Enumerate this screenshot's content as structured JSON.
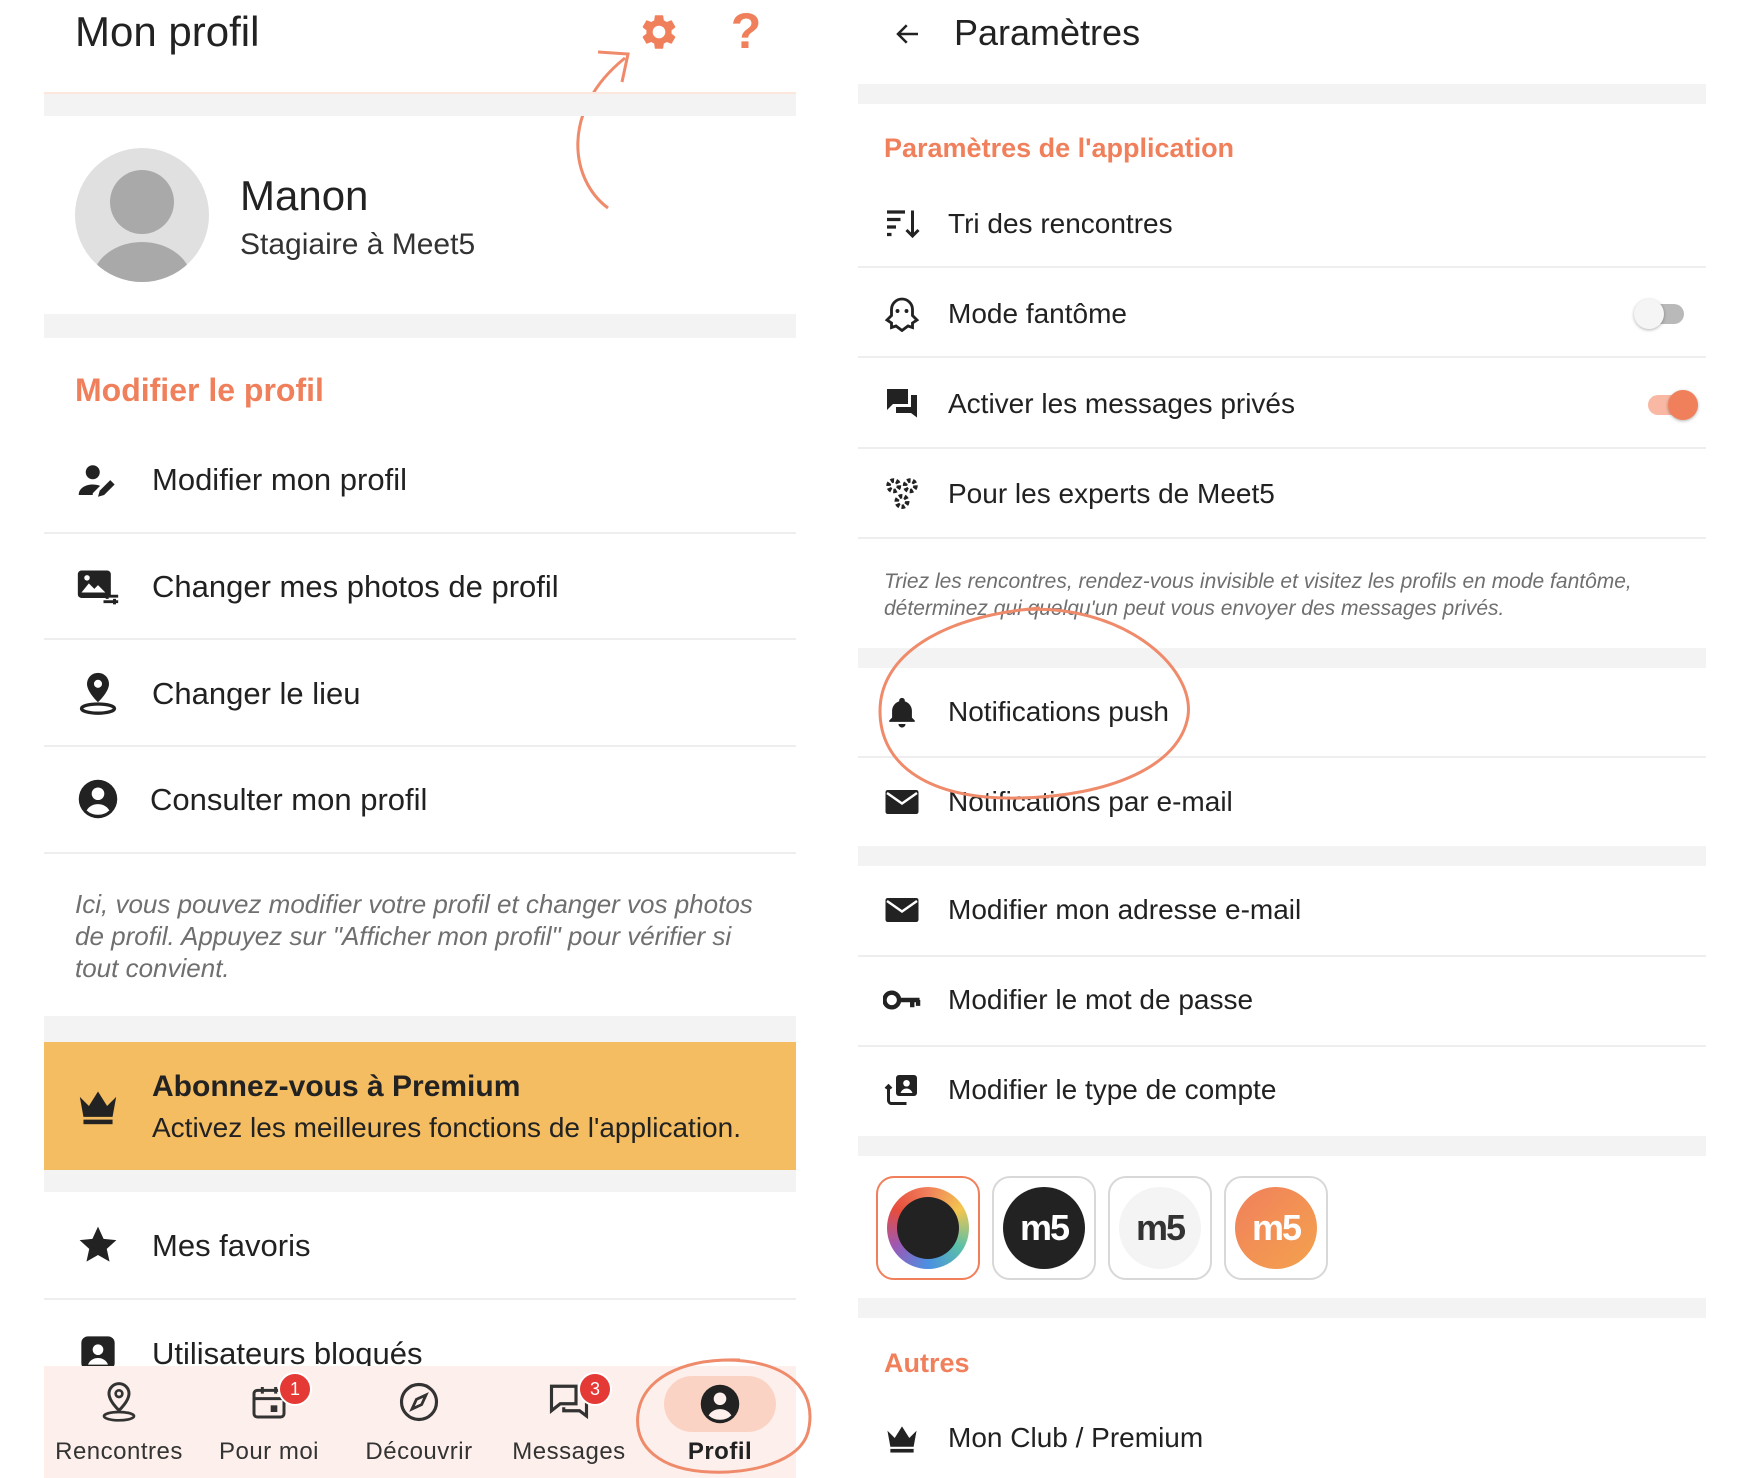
{
  "left": {
    "header_title": "Mon profil",
    "user": {
      "name": "Manon",
      "subtitle": "Stagiaire à Meet5"
    },
    "edit_section_title": "Modifier le profil",
    "edit_items": [
      {
        "label": "Modifier mon profil",
        "icon": "user-edit-icon"
      },
      {
        "label": "Changer mes photos de profil",
        "icon": "photo-edit-icon"
      },
      {
        "label": "Changer le lieu",
        "icon": "location-person-icon"
      },
      {
        "label": "Consulter mon profil",
        "icon": "account-circle-icon"
      }
    ],
    "edit_hint": "Ici, vous pouvez modifier votre profil et changer vos photos de profil. Appuyez sur \"Afficher mon profil\" pour vérifier si tout convient.",
    "premium": {
      "title": "Abonnez-vous à Premium",
      "subtitle": "Activez les meilleures fonctions de l'application.",
      "bg_color": "#f4bd62"
    },
    "more_items": [
      {
        "label": "Mes favoris",
        "icon": "star-icon"
      },
      {
        "label": "Utilisateurs bloqués",
        "icon": "blocked-user-icon"
      }
    ],
    "bottom_nav": [
      {
        "label": "Rencontres",
        "icon": "map-pin-icon",
        "badge": ""
      },
      {
        "label": "Pour moi",
        "icon": "calendar-icon",
        "badge": "1"
      },
      {
        "label": "Découvrir",
        "icon": "compass-icon",
        "badge": ""
      },
      {
        "label": "Messages",
        "icon": "chat-icon",
        "badge": "3"
      },
      {
        "label": "Profil",
        "icon": "profile-icon",
        "badge": "",
        "active": true
      }
    ]
  },
  "right": {
    "header_title": "Paramètres",
    "app_section_title": "Paramètres de l'application",
    "app_items": [
      {
        "label": "Tri des rencontres",
        "icon": "sort-icon"
      },
      {
        "label": "Mode fantôme",
        "icon": "ghost-icon",
        "toggle": false
      },
      {
        "label": "Activer les messages privés",
        "icon": "forum-icon",
        "toggle": true
      },
      {
        "label": "Pour les experts de Meet5",
        "icon": "gears-icon"
      }
    ],
    "app_hint": "Triez les rencontres, rendez-vous invisible et visitez les profils en mode fantôme, déterminez qui quelqu'un peut vous envoyer des messages privés.",
    "notif_items": [
      {
        "label": "Notifications push",
        "icon": "bell-icon"
      },
      {
        "label": "Notifications par e-mail",
        "icon": "mail-icon"
      }
    ],
    "account_items": [
      {
        "label": "Modifier mon adresse e-mail",
        "icon": "mail-icon"
      },
      {
        "label": "Modifier le mot de passe",
        "icon": "key-icon"
      },
      {
        "label": "Modifier le type de compte",
        "icon": "account-switch-icon"
      }
    ],
    "themes": [
      {
        "label": "",
        "style": "ring"
      },
      {
        "label": "m5",
        "style": "dark"
      },
      {
        "label": "m5",
        "style": "light"
      },
      {
        "label": "m5",
        "style": "orange"
      }
    ],
    "other_section_title": "Autres",
    "other_items": [
      {
        "label": "Mon Club / Premium",
        "icon": "crown-icon"
      }
    ]
  },
  "colors": {
    "accent": "#f0805c",
    "premium": "#f4bd62",
    "annotation": "#ef8a6a"
  }
}
